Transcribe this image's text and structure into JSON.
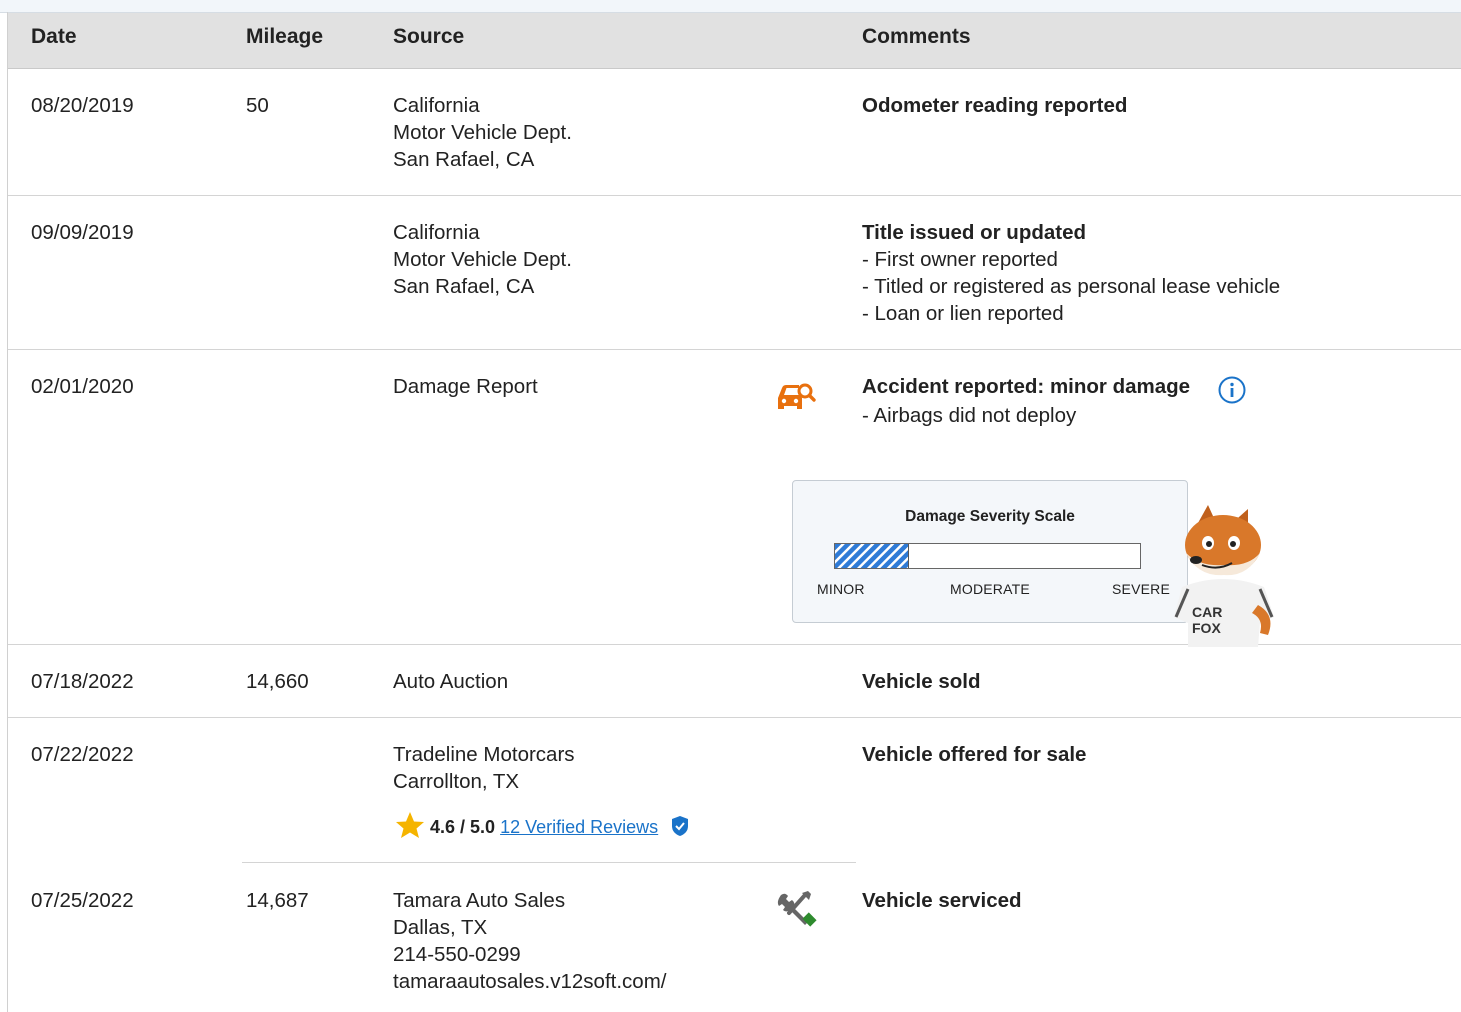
{
  "table": {
    "headers": {
      "date": "Date",
      "mileage": "Mileage",
      "source": "Source",
      "comments": "Comments"
    },
    "rows": [
      {
        "date": "08/20/2019",
        "mileage": "50",
        "source": [
          "California",
          "Motor Vehicle Dept.",
          "San Rafael, CA"
        ],
        "comment_title": "Odometer reading reported",
        "comment_items": []
      },
      {
        "date": "09/09/2019",
        "mileage": "",
        "source": [
          "California",
          "Motor Vehicle Dept.",
          "San Rafael, CA"
        ],
        "comment_title": "Title issued or updated",
        "comment_items": [
          "- First owner reported",
          "- Titled or registered as personal lease vehicle",
          "- Loan or lien reported"
        ]
      },
      {
        "date": "02/01/2020",
        "mileage": "",
        "source": [
          "Damage Report"
        ],
        "icon": "damage-report-car-icon",
        "comment_title": "Accident reported: minor damage",
        "comment_items": [
          "- Airbags did not deploy"
        ],
        "severity": {
          "title": "Damage Severity Scale",
          "level": "MINOR",
          "fill_fraction": 0.24,
          "labels": [
            "MINOR",
            "MODERATE",
            "SEVERE"
          ]
        },
        "mascot_shirt_text": "CAR FOX"
      },
      {
        "date": "07/18/2022",
        "mileage": "14,660",
        "source": [
          "Auto Auction"
        ],
        "comment_title": "Vehicle sold",
        "comment_items": []
      },
      {
        "date": "07/22/2022",
        "mileage": "",
        "source": [
          "Tradeline Motorcars",
          "Carrollton, TX"
        ],
        "rating": {
          "score": "4.6 / 5.0",
          "reviews_link": "12 Verified Reviews"
        },
        "comment_title": "Vehicle offered for sale",
        "comment_items": []
      },
      {
        "date": "07/25/2022",
        "mileage": "14,687",
        "source": [
          "Tamara Auto Sales",
          "Dallas, TX",
          "214-550-0299",
          "tamaraautosales.v12soft.com/"
        ],
        "icon": "service-tools-icon",
        "comment_title": "Vehicle serviced",
        "comment_items": []
      }
    ]
  },
  "colors": {
    "header_bg": "#e1e1e1",
    "damage_icon": "#e8700e",
    "info_icon": "#1a73c9",
    "link": "#1a73c9",
    "severity_fill": "#2f7bd6",
    "service_wrench": "#2e8b2e",
    "star": "#f5b400"
  }
}
